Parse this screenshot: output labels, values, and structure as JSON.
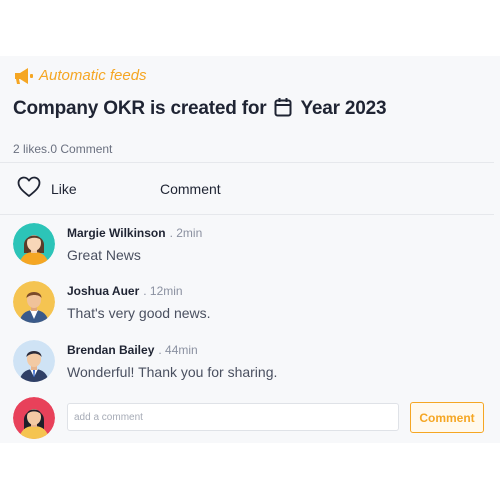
{
  "feed": {
    "tag_label": "Automatic feeds",
    "tag_icon": "megaphone-icon",
    "title_prefix": "Company OKR is created for",
    "title_icon": "calendar-icon",
    "title_year": "Year 2023",
    "likes_text": "2 likes",
    "comments_text": " .0 Comment",
    "accent_color": "#f5a623"
  },
  "actions": {
    "like_label": "Like",
    "like_icon": "heart-icon",
    "comment_label": "Comment"
  },
  "comments": [
    {
      "name": "Margie Wilkinson",
      "time": ". 2min",
      "text": "Great News",
      "avatar_color": "#2cc4b8"
    },
    {
      "name": "Joshua Auer",
      "time": ". 12min",
      "text": "That's very good news.",
      "avatar_color": "#f5c451"
    },
    {
      "name": "Brendan Bailey",
      "time": ". 44min",
      "text": "Wonderful! Thank you for sharing.",
      "avatar_color": "#cfe3f5"
    }
  ],
  "composer": {
    "placeholder": "add a comment",
    "value": "",
    "submit_label": "Comment",
    "avatar_color": "#e8415a"
  }
}
